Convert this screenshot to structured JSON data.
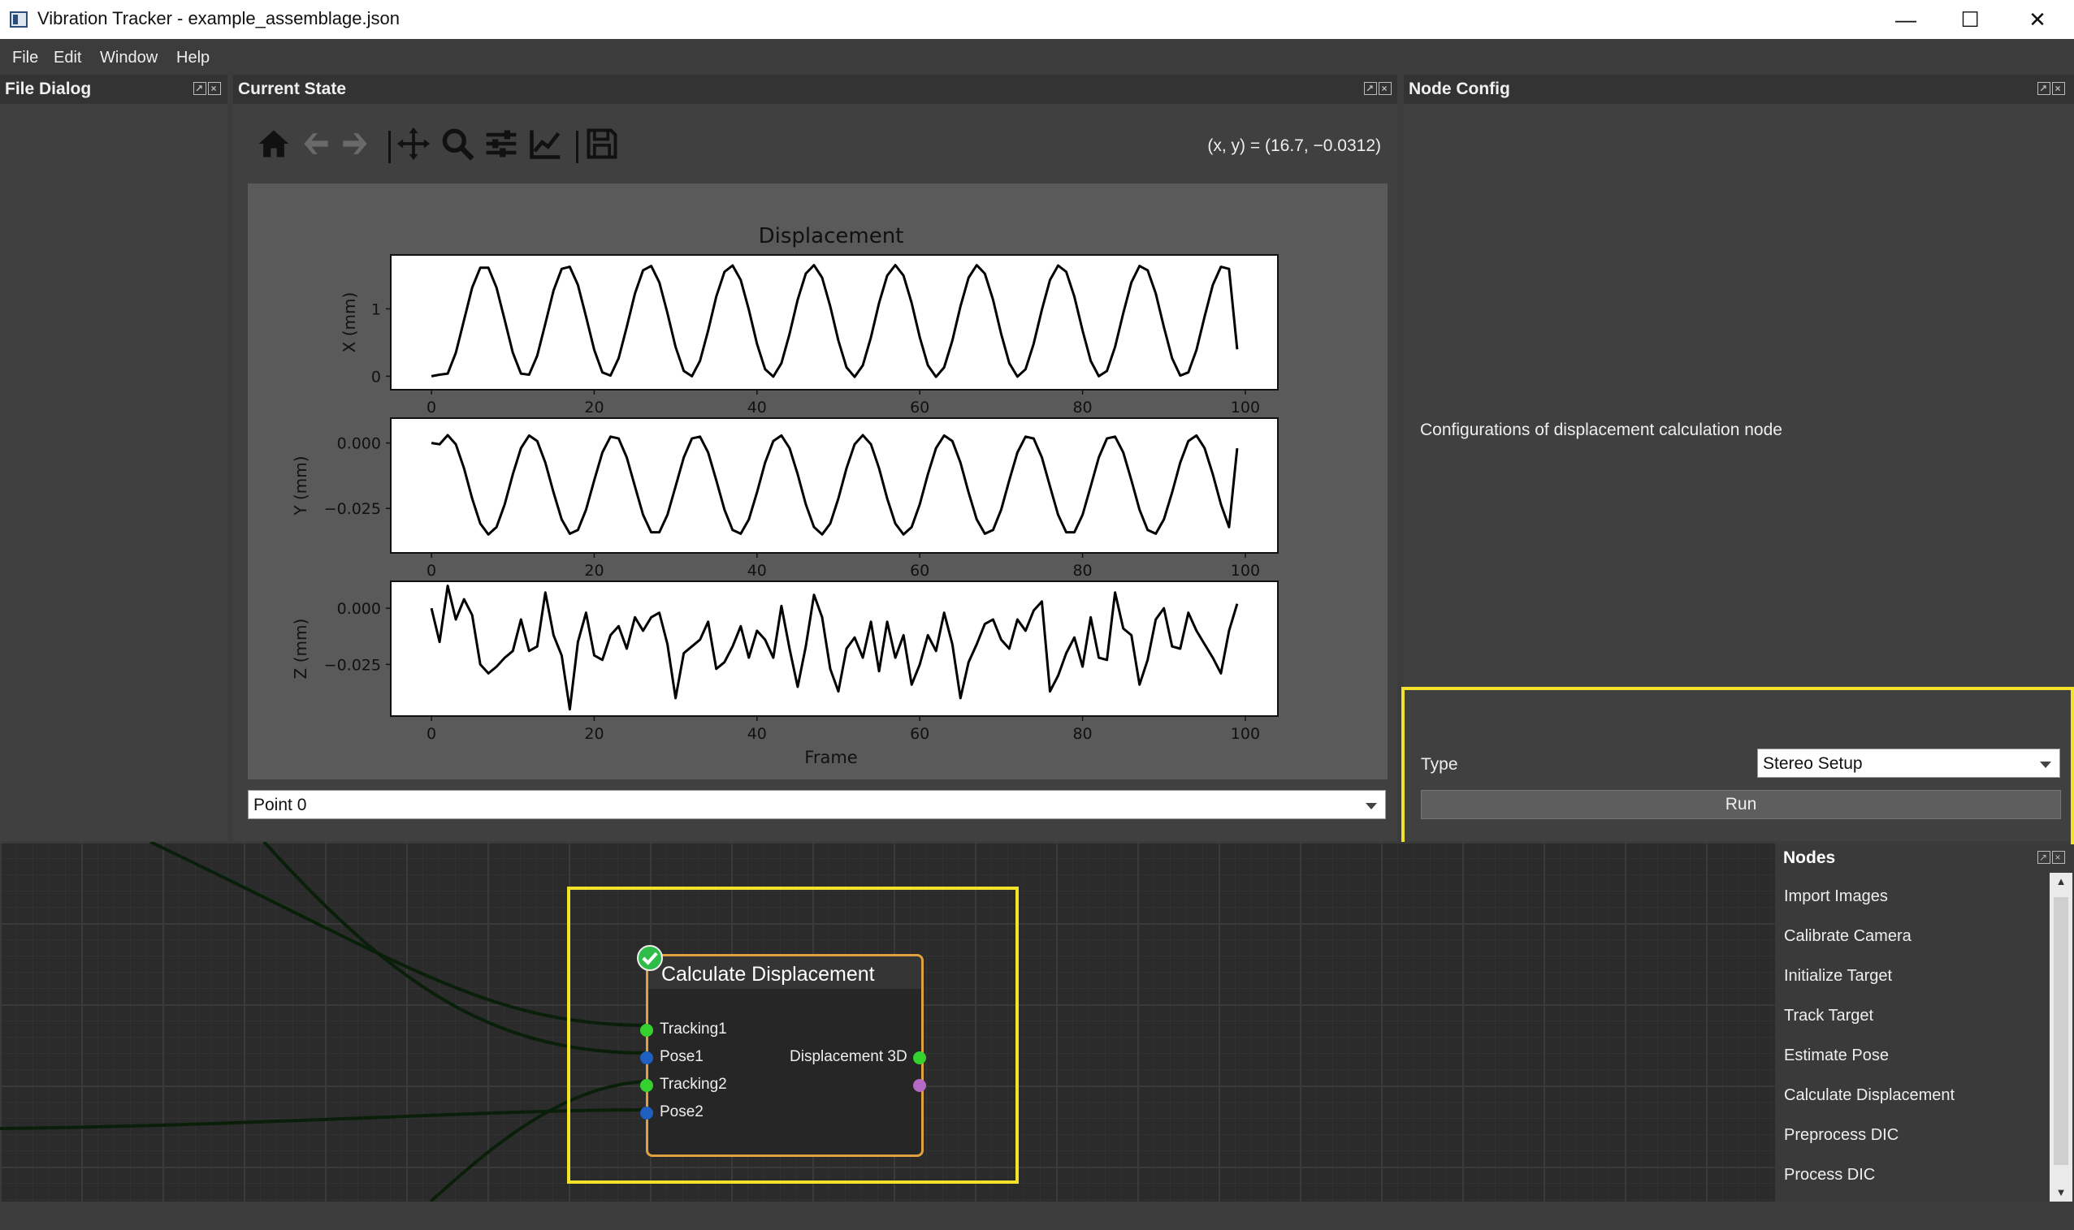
{
  "window": {
    "title": "Vibration Tracker - example_assemblage.json",
    "icon": "app-window-icon",
    "buttons": [
      "minimize-icon",
      "maximize-icon",
      "close-icon"
    ]
  },
  "menu": {
    "file": "File",
    "edit": "Edit",
    "window": "Window",
    "help": "Help"
  },
  "panels": {
    "file_dialog": "File Dialog",
    "current_state": "Current State",
    "node_config": "Node Config",
    "nodes": "Nodes"
  },
  "plot_toolbar": {
    "icons": [
      "home-icon",
      "back-arrow-icon",
      "forward-arrow-icon",
      "pan-icon",
      "zoom-icon",
      "configure-subplots-icon",
      "edit-axis-icon",
      "save-icon"
    ],
    "coords": "(x, y) = (16.7, −0.0312)"
  },
  "chart_data": {
    "type": "line",
    "title": "Displacement",
    "xlabel": "Frame",
    "x_range": [
      0,
      99
    ],
    "xticks": [
      "0",
      "20",
      "40",
      "60",
      "80",
      "100"
    ],
    "grid": false,
    "subplots": [
      {
        "ylabel": "X (mm)",
        "yticks": [
          "0",
          "1"
        ],
        "ylim": [
          -0.2,
          1.8
        ],
        "period": 10.1,
        "amplitude": 0.83,
        "offset": 0.82,
        "phase_frame": 6.5,
        "start_value": 0.0,
        "end_value": 0.4
      },
      {
        "ylabel": "Y (mm)",
        "yticks": [
          "0.000",
          "−0.025"
        ],
        "ylim": [
          -0.042,
          0.0095
        ],
        "period": 10.2,
        "amplitude": 0.019,
        "offset": -0.016,
        "phase_frame": 2,
        "start_value": 0.0,
        "end_value": -0.002
      },
      {
        "ylabel": "Z (mm)",
        "yticks": [
          "0.000",
          "−0.025"
        ],
        "ylim": [
          -0.048,
          0.012
        ],
        "values": [
          0.0,
          -0.015,
          0.01,
          -0.005,
          0.004,
          -0.003,
          -0.025,
          -0.029,
          -0.026,
          -0.022,
          -0.019,
          -0.005,
          -0.019,
          -0.017,
          0.007,
          -0.012,
          -0.021,
          -0.045,
          -0.015,
          -0.002,
          -0.021,
          -0.023,
          -0.012,
          -0.008,
          -0.018,
          -0.004,
          -0.01,
          -0.004,
          -0.002,
          -0.016,
          -0.04,
          -0.02,
          -0.017,
          -0.014,
          -0.006,
          -0.027,
          -0.024,
          -0.017,
          -0.008,
          -0.022,
          -0.01,
          -0.014,
          -0.022,
          0.001,
          -0.018,
          -0.035,
          -0.017,
          0.006,
          -0.004,
          -0.027,
          -0.037,
          -0.018,
          -0.013,
          -0.022,
          -0.006,
          -0.028,
          -0.006,
          -0.022,
          -0.012,
          -0.034,
          -0.025,
          -0.012,
          -0.019,
          -0.002,
          -0.016,
          -0.04,
          -0.024,
          -0.016,
          -0.007,
          -0.005,
          -0.014,
          -0.018,
          -0.005,
          -0.01,
          -0.001,
          0.003,
          -0.037,
          -0.03,
          -0.02,
          -0.013,
          -0.026,
          -0.004,
          -0.022,
          -0.023,
          0.007,
          -0.009,
          -0.012,
          -0.034,
          -0.023,
          -0.005,
          0.0,
          -0.017,
          -0.018,
          -0.002,
          -0.01,
          -0.016,
          -0.022,
          -0.029,
          -0.01,
          0.002
        ]
      }
    ]
  },
  "point_selector": {
    "value": "Point 0"
  },
  "node_config": {
    "description": "Configurations of displacement calculation node",
    "type_label": "Type",
    "type_value": "Stereo Setup",
    "run_label": "Run"
  },
  "graph_node": {
    "title": "Calculate Displacement",
    "status_icon": "checkmark-icon",
    "inputs": [
      "Tracking1",
      "Pose1",
      "Tracking2",
      "Pose2"
    ],
    "outputs": [
      "Displacement 3D"
    ],
    "port_colors": {
      "tracking": "#35d22f",
      "pose": "#1f5fbf",
      "output_displacement": "#35d22f",
      "output_extra": "#b36ac2"
    },
    "border_color": "#e0a040"
  },
  "nodes_list": [
    "Import Images",
    "Calibrate Camera",
    "Initialize Target",
    "Track Target",
    "Estimate Pose",
    "Calculate Displacement",
    "Preprocess DIC",
    "Process DIC"
  ],
  "colors": {
    "highlight": "#f2e22a",
    "background": "#3c3c3c",
    "panel": "#404040"
  }
}
